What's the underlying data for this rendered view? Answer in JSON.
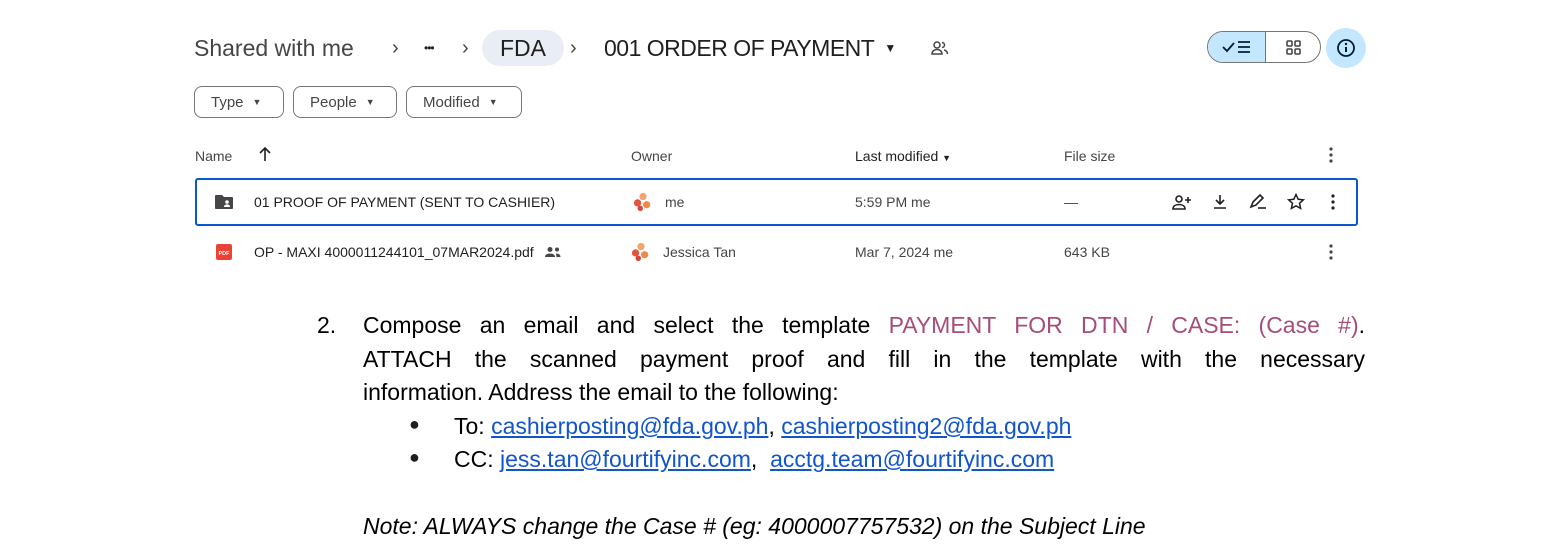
{
  "breadcrumb": {
    "shared": "Shared with me",
    "ellipsis": "•••",
    "fda": "FDA",
    "current": "001 ORDER OF PAYMENT"
  },
  "filters": {
    "type": "Type",
    "people": "People",
    "modified": "Modified"
  },
  "table": {
    "headers": {
      "name": "Name",
      "owner": "Owner",
      "modified": "Last modified",
      "size": "File size"
    },
    "rows": [
      {
        "name": "01 PROOF OF PAYMENT (SENT TO CASHIER)",
        "owner": "me",
        "modified": "5:59 PM",
        "modified_by": "me",
        "size": "—",
        "icon": "shared-folder-icon"
      },
      {
        "name": "OP -  MAXI 4000011244101_07MAR2024.pdf",
        "owner": "Jessica Tan",
        "modified": "Mar 7, 2024",
        "modified_by": "me",
        "size": "643 KB",
        "icon": "pdf-icon"
      }
    ]
  },
  "doc": {
    "step_number": "2.",
    "line1_a": "Compose an email and select the template",
    "line1_template": "PAYMENT FOR DTN / CASE: (Case #)",
    "line1_end": ".",
    "line2": "ATTACH the scanned payment proof and fill in the template with the necessary",
    "line3": "information. Address the email to the following:",
    "to_label": "To:",
    "to_email1": "cashierposting@fda.gov.ph",
    "to_sep": ",",
    "to_email2": "cashierposting2@fda.gov.ph",
    "cc_label": "CC:",
    "cc_email1": "jess.tan@fourtifyinc.com",
    "cc_sep": ",",
    "cc_email2": "acctg.team@fourtifyinc.com",
    "note": "Note: ALWAYS change the Case # (eg: 4000007757532) on the Subject Line"
  },
  "colors": {
    "accent": "#0b57d0",
    "chip_bg": "#c2e7ff",
    "template_text": "#a64d79",
    "link": "#1155cc"
  }
}
